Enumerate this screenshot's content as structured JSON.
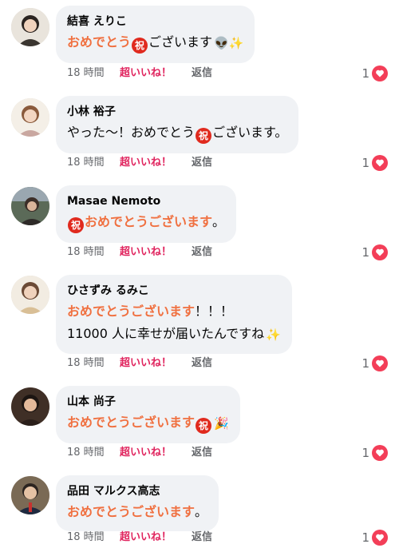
{
  "comments": [
    {
      "author": "結喜 えりこ",
      "time": "18 時間",
      "like_label": "超いいね！",
      "reply_label": "返信",
      "reaction_count": "1",
      "lines": [
        {
          "parts": [
            {
              "type": "hl",
              "text": "おめでとう"
            },
            {
              "type": "iwai",
              "text": "祝"
            },
            {
              "type": "text",
              "text": "ございます"
            },
            {
              "type": "emoji",
              "text": "👽✨"
            }
          ]
        }
      ]
    },
    {
      "author": "小林 裕子",
      "time": "18 時間",
      "like_label": "超いいね！",
      "reply_label": "返信",
      "reaction_count": "1",
      "lines": [
        {
          "parts": [
            {
              "type": "text",
              "text": "やった〜！おめでとう"
            },
            {
              "type": "iwai",
              "text": "祝"
            },
            {
              "type": "text",
              "text": "ございます。"
            }
          ]
        }
      ]
    },
    {
      "author": "Masae Nemoto",
      "time": "18 時間",
      "like_label": "超いいね！",
      "reply_label": "返信",
      "reaction_count": "1",
      "lines": [
        {
          "parts": [
            {
              "type": "iwai",
              "text": "祝"
            },
            {
              "type": "hl",
              "text": "おめでとうございます"
            },
            {
              "type": "text",
              "text": "。"
            }
          ]
        }
      ]
    },
    {
      "author": "ひさずみ るみこ",
      "time": "18 時間",
      "like_label": "超いいね！",
      "reply_label": "返信",
      "reaction_count": "1",
      "lines": [
        {
          "parts": [
            {
              "type": "hl",
              "text": "おめでとうございます"
            },
            {
              "type": "text",
              "text": "！！！"
            }
          ]
        },
        {
          "parts": [
            {
              "type": "text",
              "text": "11000 人に幸せが届いたんですね"
            },
            {
              "type": "emoji",
              "text": "✨"
            }
          ]
        }
      ]
    },
    {
      "author": "山本 尚子",
      "time": "18 時間",
      "like_label": "超いいね！",
      "reply_label": "返信",
      "reaction_count": "1",
      "lines": [
        {
          "parts": [
            {
              "type": "hl",
              "text": "おめでとうございます"
            },
            {
              "type": "iwai",
              "text": "祝"
            },
            {
              "type": "emoji",
              "text": "🎉"
            }
          ]
        }
      ]
    },
    {
      "author": "品田 マルクス高志",
      "time": "18 時間",
      "like_label": "超いいね！",
      "reply_label": "返信",
      "reaction_count": "1",
      "lines": [
        {
          "parts": [
            {
              "type": "hl",
              "text": "おめでとうございます"
            },
            {
              "type": "text",
              "text": "。"
            }
          ]
        }
      ]
    }
  ],
  "colors": {
    "bubble": "#f0f2f5",
    "highlight": "#f07040",
    "super_like": "#e0245e",
    "heart": "#f33e58",
    "iwai_badge": "#e02a1e"
  },
  "icons": {
    "reaction": "heart-reaction-icon",
    "avatar": "avatar-photo"
  }
}
